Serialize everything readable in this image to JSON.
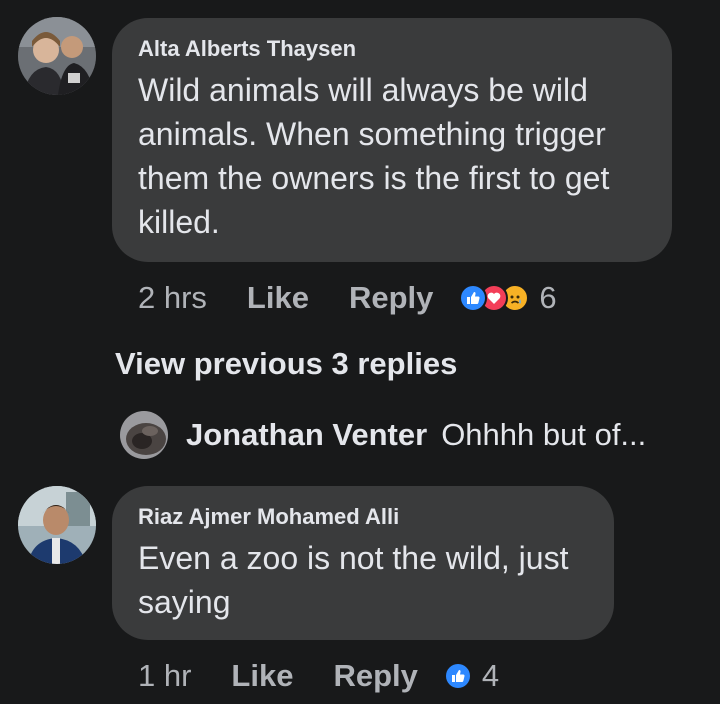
{
  "comments": [
    {
      "author": "Alta Alberts Thaysen",
      "lines": [
        "Wild animals will always be wild",
        "animals. When something trigger",
        "them the owners is the first to get",
        "killed."
      ],
      "time": "2 hrs",
      "like": "Like",
      "reply": "Reply",
      "reaction_icons": [
        "like-reaction-icon",
        "love-reaction-icon",
        "sad-reaction-icon"
      ],
      "reaction_count": "6"
    },
    {
      "author": "Riaz Ajmer Mohamed Alli",
      "lines": [
        "Even a zoo is not the wild, just",
        "saying"
      ],
      "time": "1 hr",
      "like": "Like",
      "reply": "Reply",
      "reaction_icons": [
        "like-reaction-icon"
      ],
      "reaction_count": "4"
    }
  ],
  "thread": {
    "view_previous": "View previous 3 replies",
    "latest_reply": {
      "author": "Jonathan Venter",
      "text": "Ohhhh but of..."
    }
  },
  "colors": {
    "background": "#18191a",
    "bubble": "#3a3b3c",
    "text": "#e4e6eb",
    "secondary": "#b0b3b8",
    "like_blue": "#2d88ff",
    "love_red": "#f33e58",
    "sad_yellow": "#f7b125"
  }
}
